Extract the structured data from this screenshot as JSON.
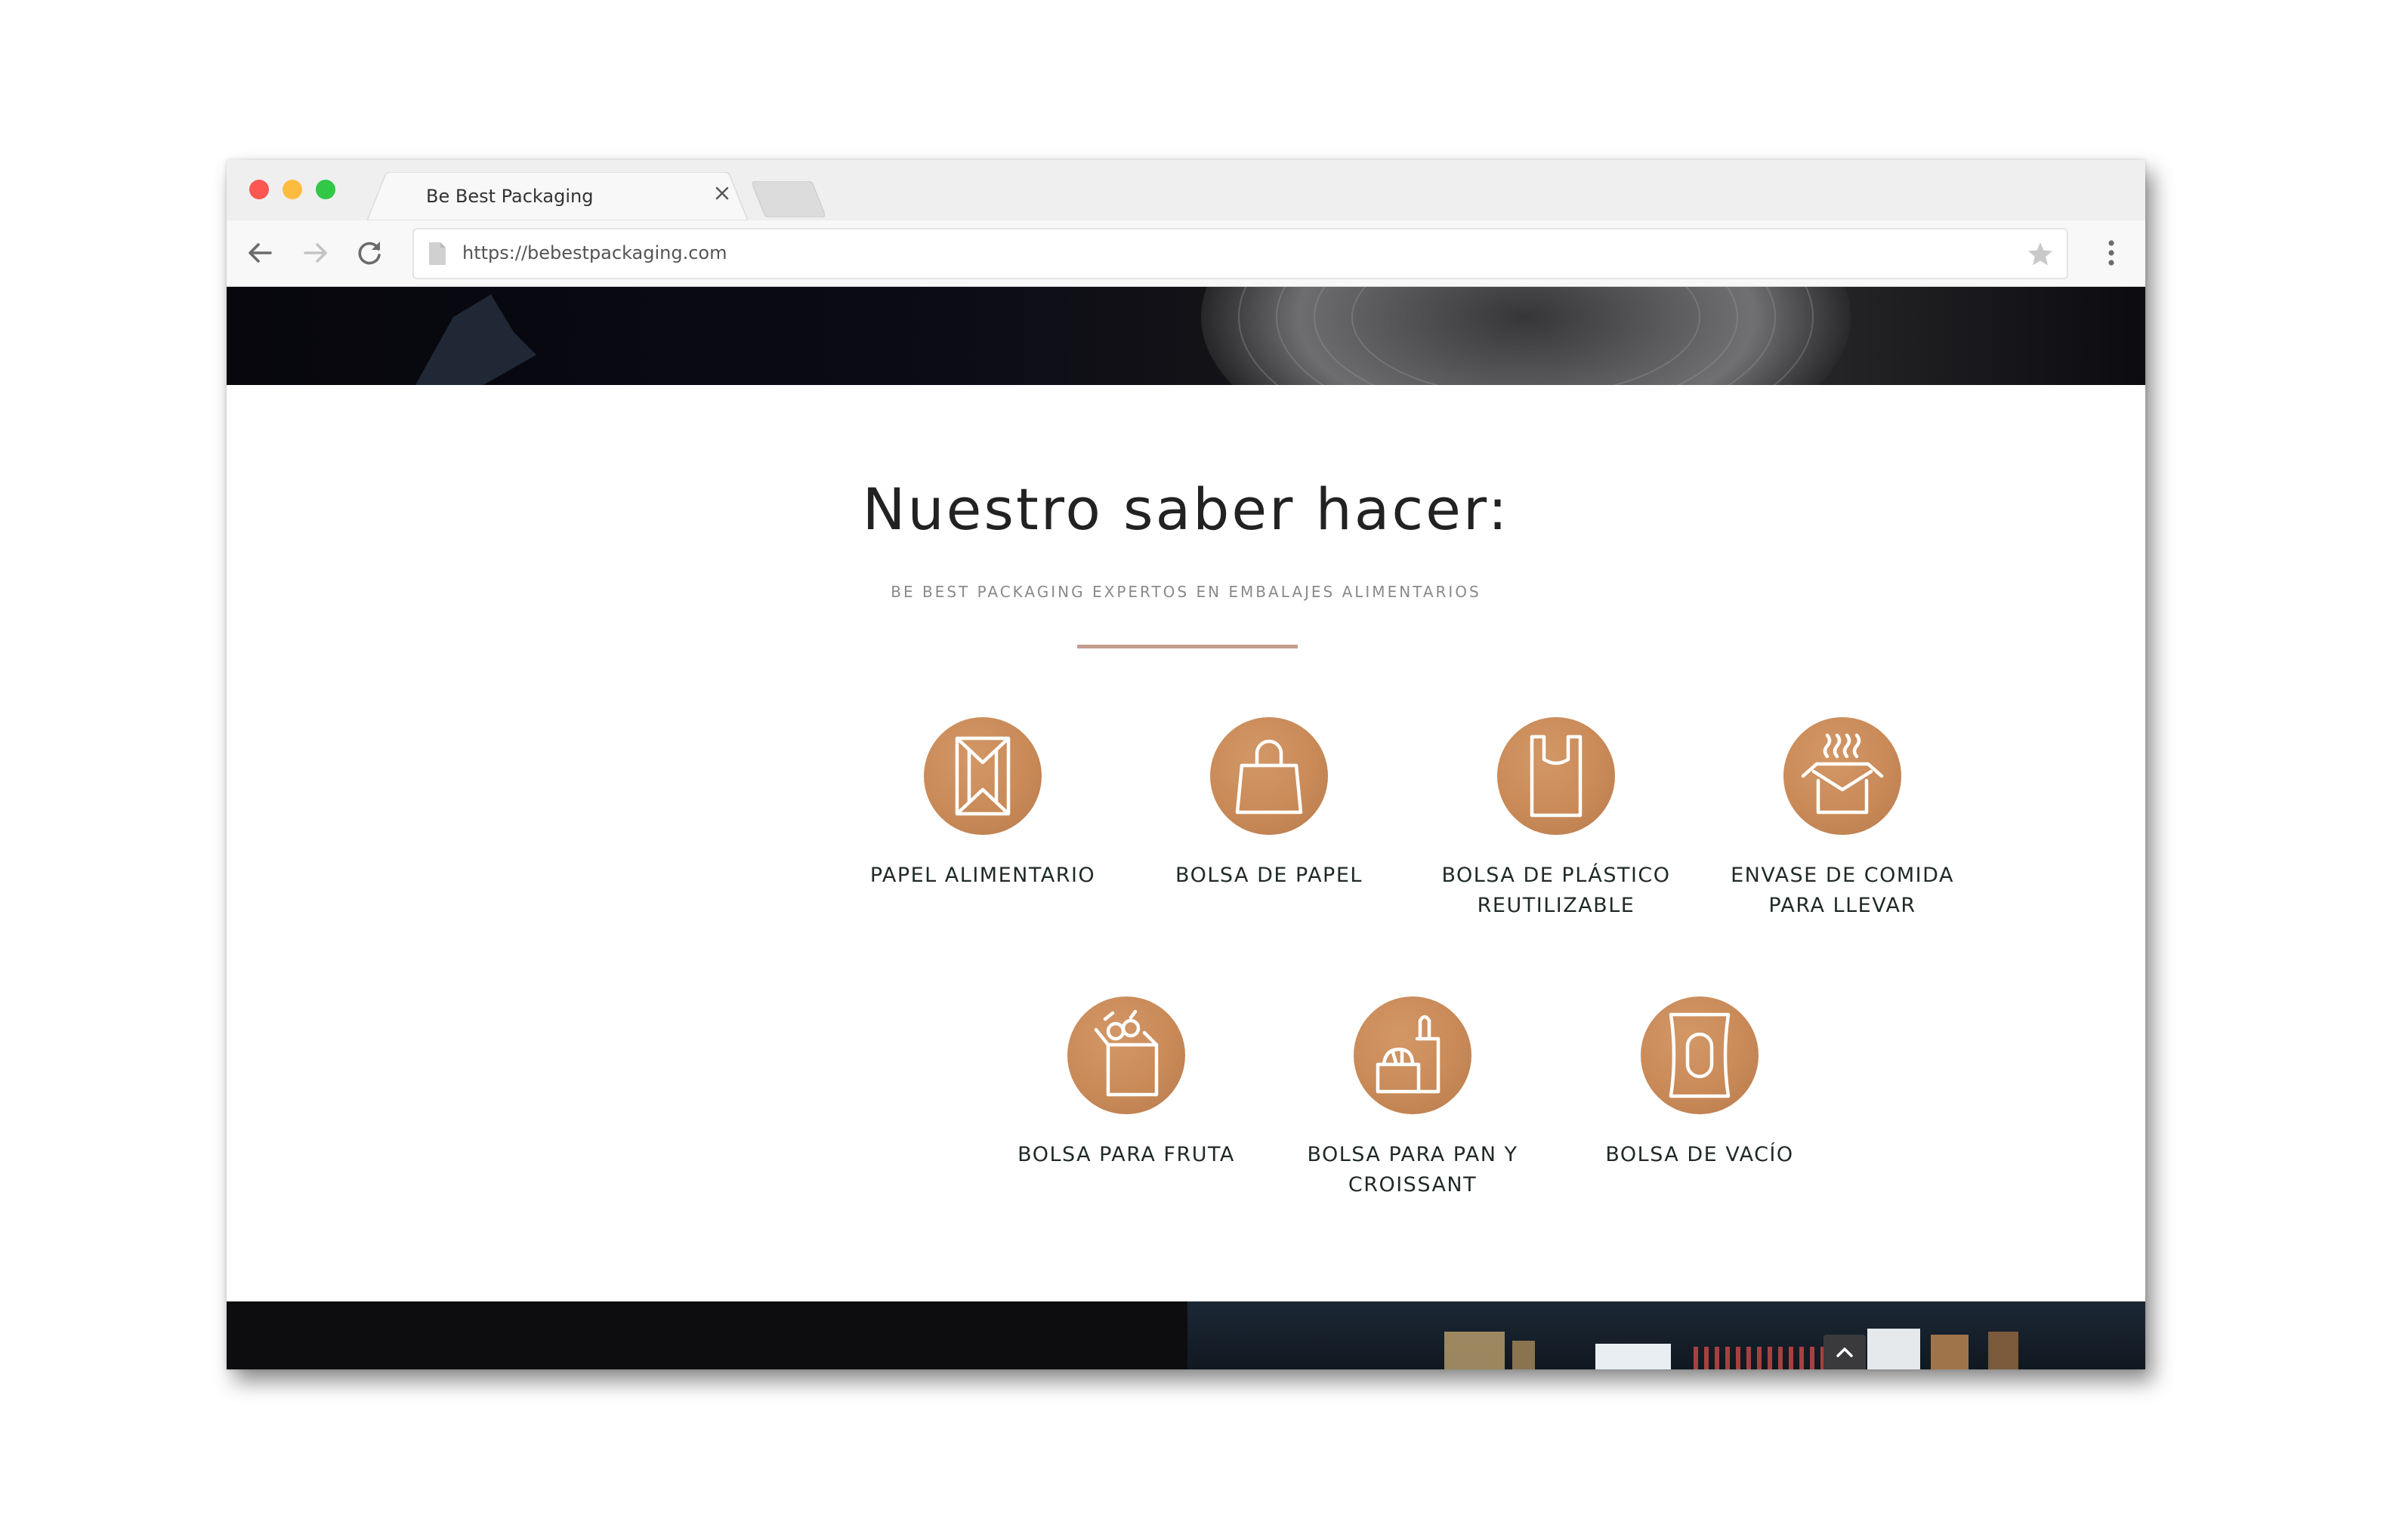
{
  "browser": {
    "tab_title": "Be Best Packaging",
    "url": "https://bebestpackaging.com"
  },
  "section": {
    "title": "Nuestro saber hacer:",
    "subtitle": "BE BEST PACKAGING EXPERTOS EN EMBALAJES ALIMENTARIOS"
  },
  "services": [
    {
      "label": "PAPEL ALIMENTARIO",
      "icon": "food-paper-icon"
    },
    {
      "label": "BOLSA DE PAPEL",
      "icon": "paper-bag-icon"
    },
    {
      "label": "BOLSA DE PLÁSTICO REUTILIZABLE",
      "icon": "plastic-bag-icon"
    },
    {
      "label": "ENVASE DE COMIDA PARA LLEVAR",
      "icon": "takeaway-box-icon"
    },
    {
      "label": "BOLSA PARA FRUTA",
      "icon": "fruit-bag-icon"
    },
    {
      "label": "BOLSA PARA PAN Y CROISSANT",
      "icon": "bread-bag-icon"
    },
    {
      "label": "BOLSA DE VACÍO",
      "icon": "vacuum-bag-icon"
    }
  ],
  "colors": {
    "icon_circle": "#c98a58",
    "divider": "#c49d8f",
    "label_text": "#1f2a27"
  }
}
